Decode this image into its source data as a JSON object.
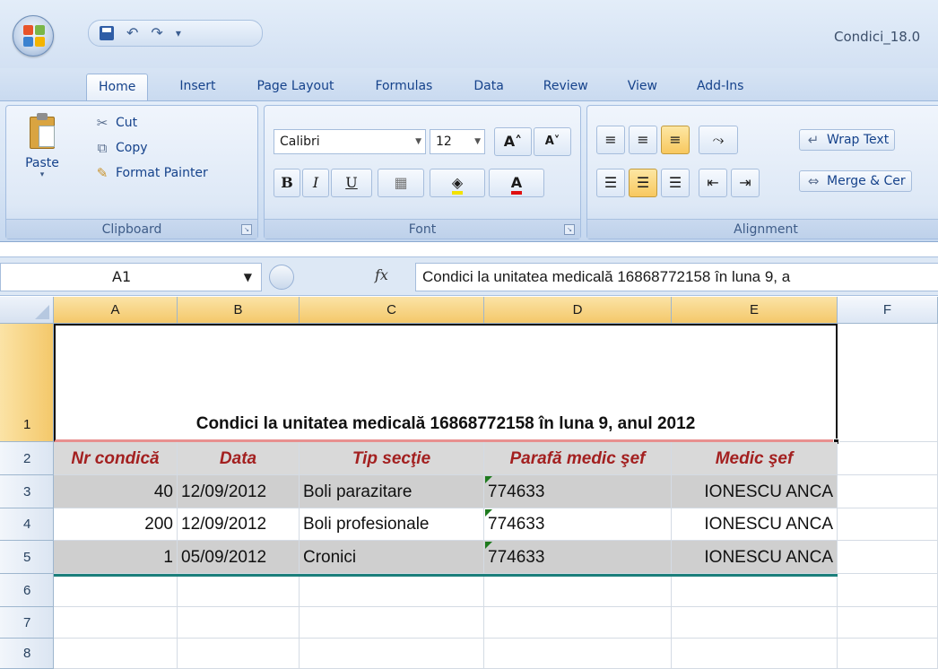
{
  "window": {
    "title": "Condici_18.0"
  },
  "tabs": [
    "Home",
    "Insert",
    "Page Layout",
    "Formulas",
    "Data",
    "Review",
    "View",
    "Add-Ins"
  ],
  "ribbon": {
    "clipboard": {
      "label": "Clipboard",
      "paste": "Paste",
      "cut": "Cut",
      "copy": "Copy",
      "format_painter": "Format Painter"
    },
    "font": {
      "label": "Font",
      "name": "Calibri",
      "size": "12",
      "bold": "B",
      "italic": "I",
      "underline": "U"
    },
    "alignment": {
      "label": "Alignment",
      "wrap_text": "Wrap Text",
      "merge_center": "Merge & Cer"
    }
  },
  "formula_bar": {
    "name_box": "A1",
    "fx": "fx",
    "content": "Condici la unitatea medicală 16868772158 în luna 9, a"
  },
  "grid": {
    "columns": [
      "A",
      "B",
      "C",
      "D",
      "E",
      "F"
    ],
    "rows": [
      "1",
      "2",
      "3",
      "4",
      "5",
      "6",
      "7",
      "8"
    ],
    "title": "Condici la unitatea medicală 16868772158 în luna 9, anul 2012",
    "headers": [
      "Nr condică",
      "Data",
      "Tip secţie",
      "Parafă medic şef",
      "Medic şef"
    ],
    "data": [
      [
        "40",
        "12/09/2012",
        "Boli parazitare",
        "774633",
        "IONESCU ANCA"
      ],
      [
        "200",
        "12/09/2012",
        "Boli profesionale",
        "774633",
        "IONESCU ANCA"
      ],
      [
        "1",
        "05/09/2012",
        "Cronici",
        "774633",
        "IONESCU ANCA"
      ]
    ]
  },
  "colors": {
    "header_text": "#a32020",
    "band": "#cfcfcf",
    "table_border": "#1b7f7b"
  }
}
